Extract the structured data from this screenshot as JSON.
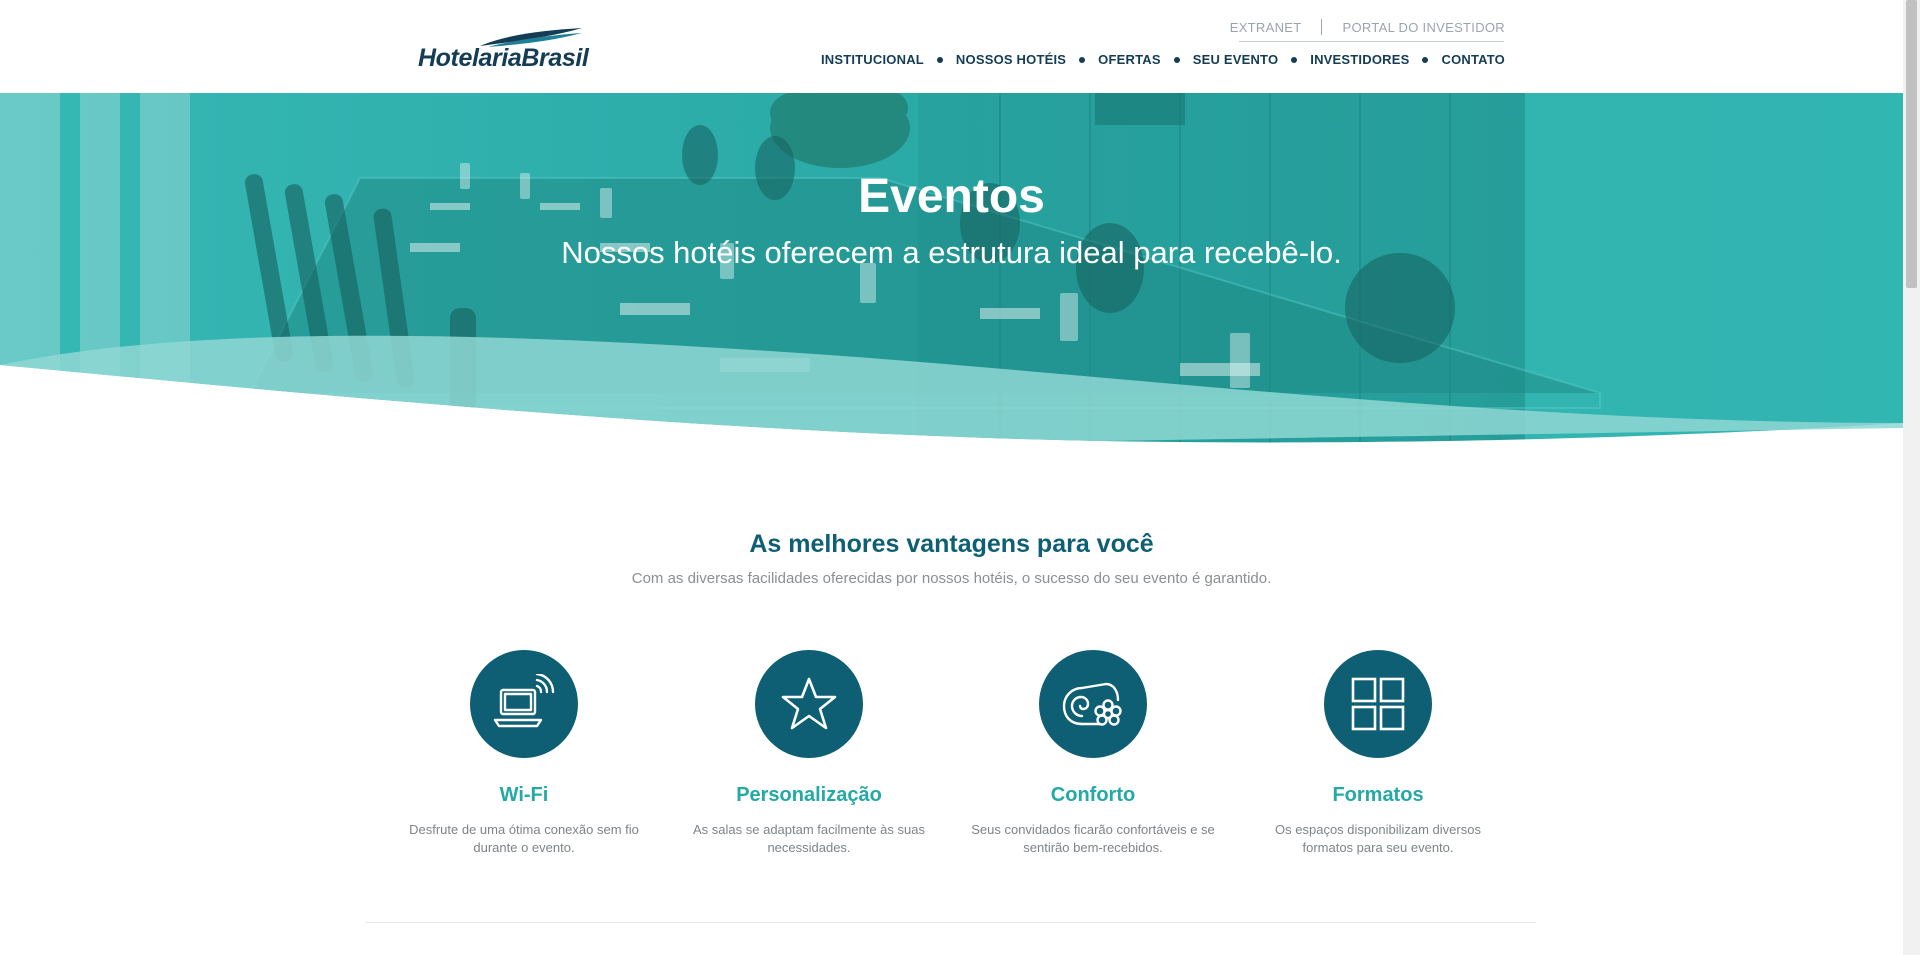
{
  "brand": {
    "logo_text": "HotelariaBrasil"
  },
  "topbar": {
    "extranet": "EXTRANET",
    "investor_portal": "PORTAL DO INVESTIDOR"
  },
  "nav": {
    "items": [
      "INSTITUCIONAL",
      "NOSSOS HOTÉIS",
      "OFERTAS",
      "SEU EVENTO",
      "INVESTIDORES",
      "CONTATO"
    ]
  },
  "hero": {
    "title": "Eventos",
    "subtitle": "Nossos hotéis oferecem a estrutura ideal para recebê-lo."
  },
  "benefits": {
    "title": "As melhores vantagens para você",
    "subtitle": "Com as diversas facilidades oferecidas por nossos hotéis, o sucesso do seu evento é garantido.",
    "items": [
      {
        "icon": "laptop-wifi-icon",
        "title": "Wi-Fi",
        "desc": "Desfrute de uma ótima conexão sem fio durante o evento."
      },
      {
        "icon": "star-icon",
        "title": "Personalização",
        "desc": "As salas se adaptam facilmente às suas necessidades."
      },
      {
        "icon": "towel-flower-icon",
        "title": "Conforto",
        "desc": "Seus convidados ficarão confortáveis e se sentirão bem-recebidos."
      },
      {
        "icon": "grid-icon",
        "title": "Formatos",
        "desc": "Os espaços disponibilizam diversos formatos para seu evento."
      }
    ]
  },
  "colors": {
    "navy": "#143c55",
    "teal_dark": "#0e5f73",
    "teal": "#23a9a6",
    "hero_teal": "#2db3b0"
  }
}
